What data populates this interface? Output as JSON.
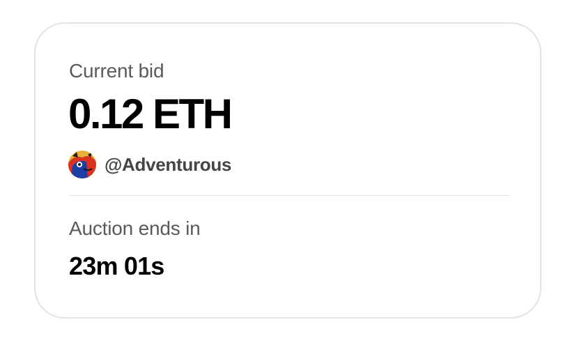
{
  "auction": {
    "current_bid_label": "Current bid",
    "current_bid_value": "0.12 ETH",
    "bidder_handle": "@Adventurous",
    "ends_label": "Auction ends in",
    "countdown": "23m 01s"
  },
  "icons": {
    "avatar": "bidder-avatar-image"
  },
  "colors": {
    "card_border": "#e3e3e3",
    "label_text": "#5a5a5a",
    "value_text": "#000000",
    "handle_text": "#444444",
    "divider": "#e2e2e2"
  }
}
